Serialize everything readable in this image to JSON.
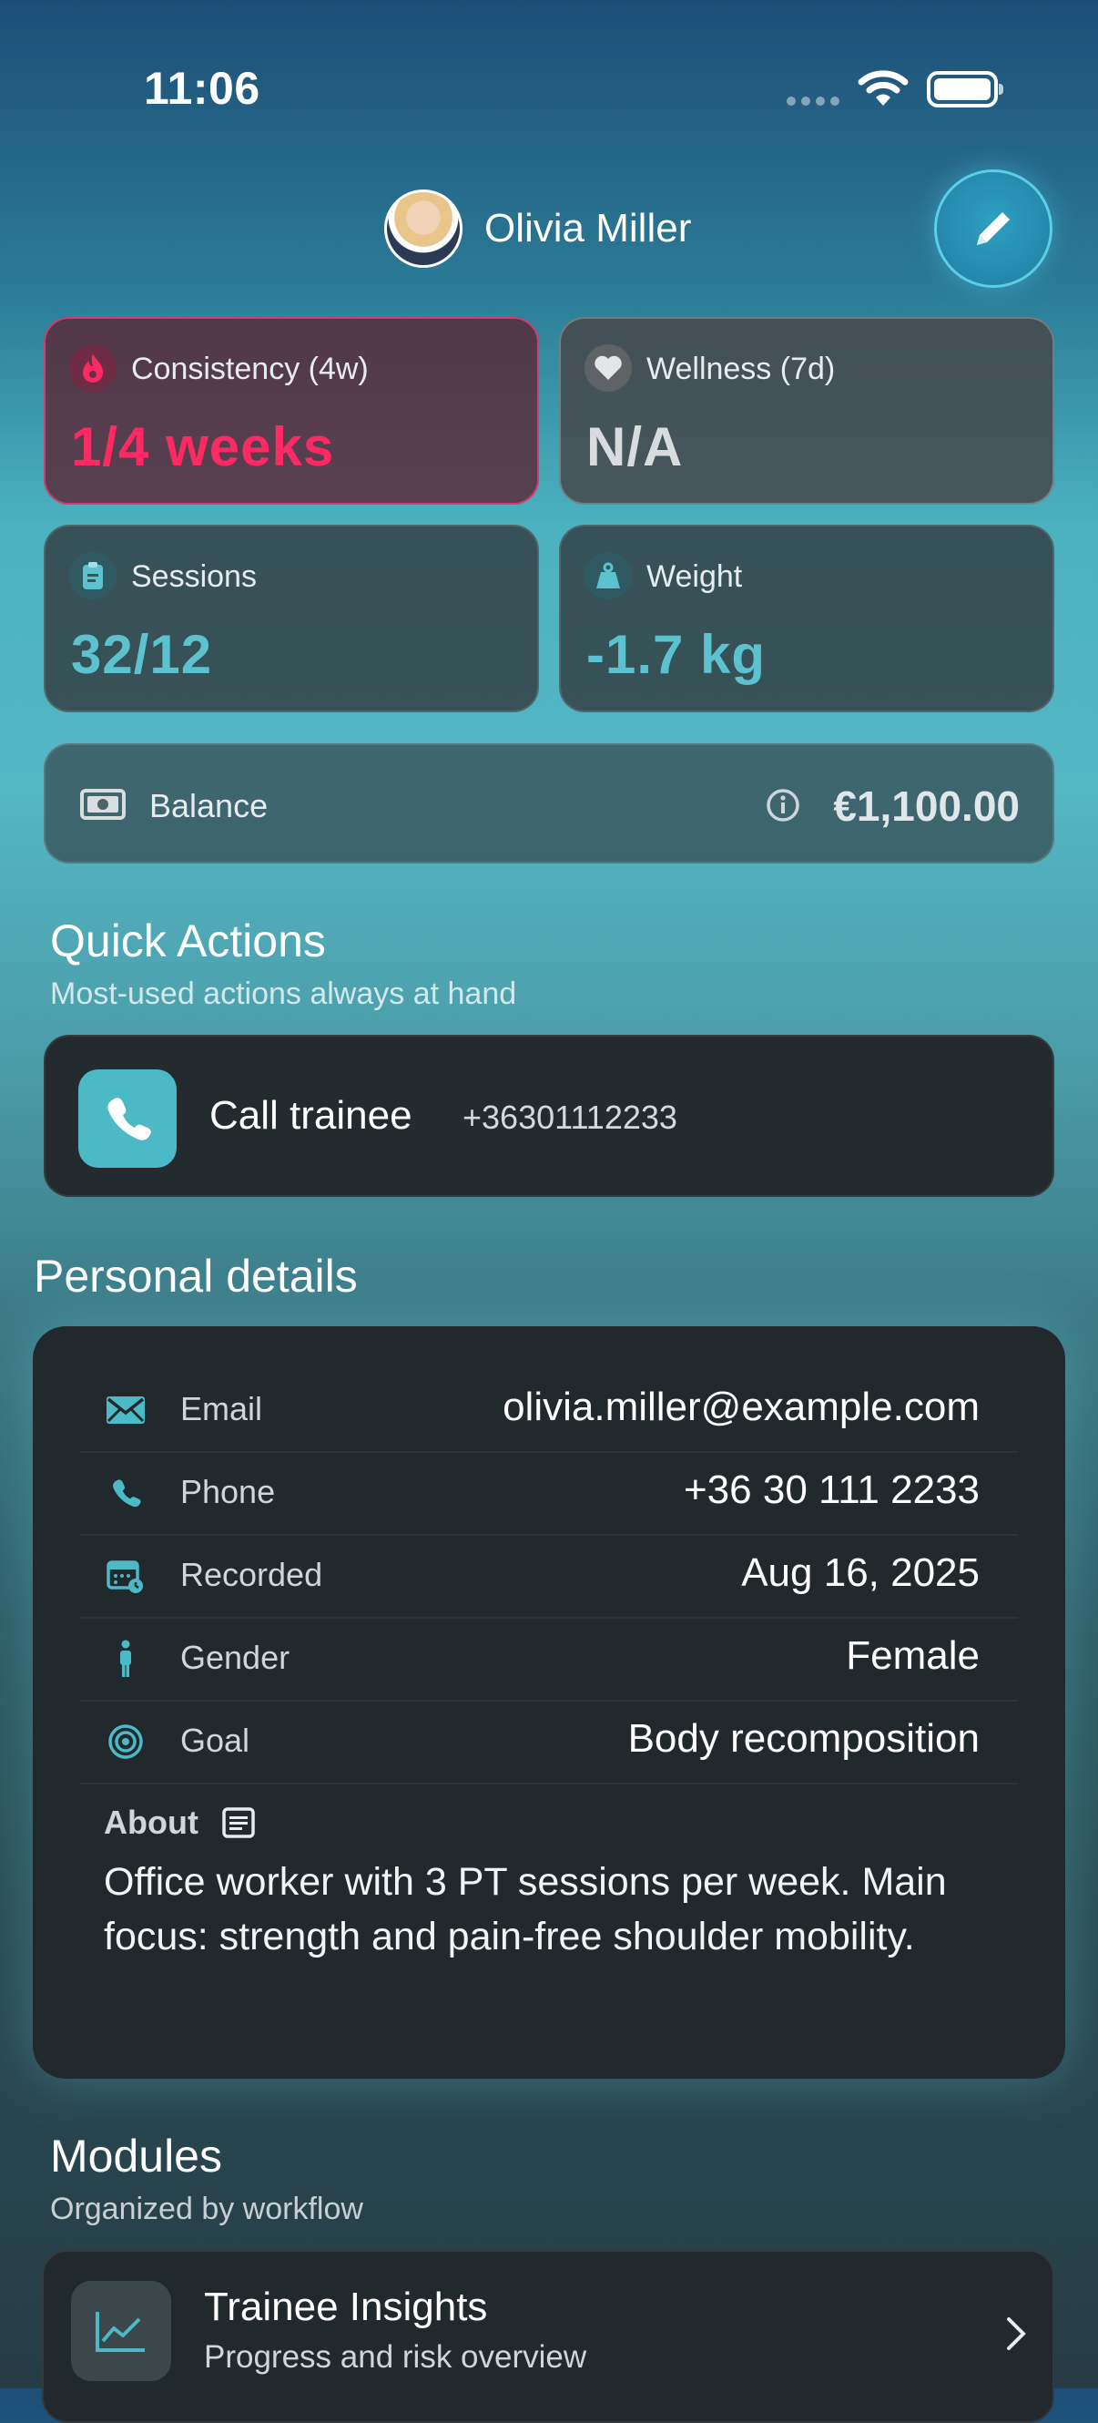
{
  "status_bar": {
    "time": "11:06"
  },
  "header": {
    "name": "Olivia Miller",
    "edit_icon": "pencil-icon"
  },
  "stats": [
    {
      "label": "Consistency (4w)",
      "value": "1/4 weeks",
      "icon": "flame-icon",
      "color": "#ff2a63"
    },
    {
      "label": "Wellness (7d)",
      "value": "N/A",
      "icon": "heart-icon",
      "color": "#d9dcde"
    },
    {
      "label": "Sessions",
      "value": "32/12",
      "icon": "clipboard-icon",
      "color": "#5cc2cf"
    },
    {
      "label": "Weight",
      "value": "-1.7 kg",
      "icon": "weight-icon",
      "color": "#5cc2cf"
    }
  ],
  "balance": {
    "label": "Balance",
    "value": "€1,100.00",
    "icon": "banknote-icon"
  },
  "quick_actions": {
    "title": "Quick Actions",
    "subtitle": "Most-used actions always at hand",
    "call": {
      "label": "Call trainee",
      "phone": "+36301112233"
    }
  },
  "personal": {
    "title": "Personal details",
    "rows": [
      {
        "label": "Email",
        "value": "olivia.miller@example.com"
      },
      {
        "label": "Phone",
        "value": "+36 30 111 2233"
      },
      {
        "label": "Recorded",
        "value": "Aug 16, 2025"
      },
      {
        "label": "Gender",
        "value": "Female"
      },
      {
        "label": "Goal",
        "value": "Body recomposition"
      }
    ],
    "about_label": "About",
    "about_text": "Office worker with 3 PT sessions per week. Main focus: strength and pain-free shoulder mobility."
  },
  "modules": {
    "title": "Modules",
    "subtitle": "Organized by workflow",
    "items": [
      {
        "title": "Trainee Insights",
        "subtitle": "Progress and risk overview"
      }
    ]
  },
  "colors": {
    "accent": "#4bb9c6",
    "alert": "#ff2a63"
  }
}
